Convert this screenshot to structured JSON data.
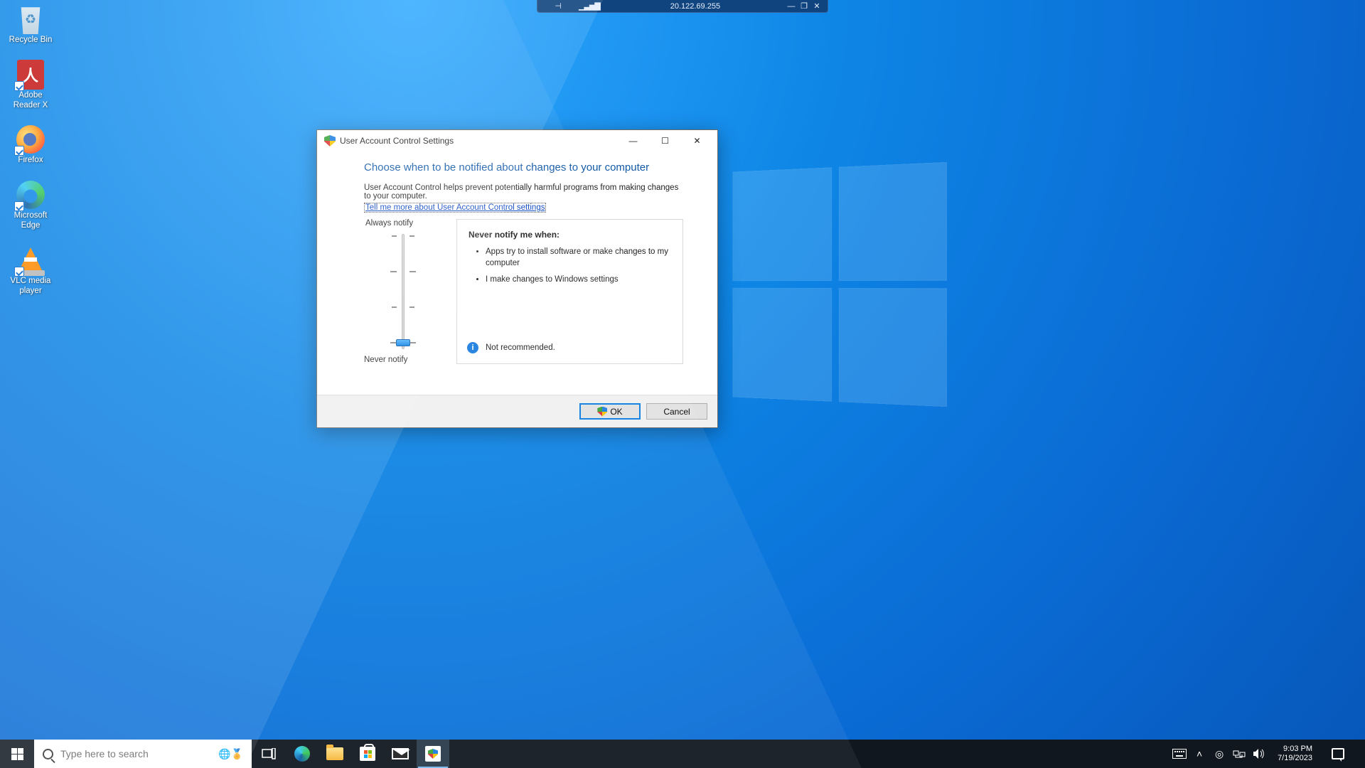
{
  "remote_bar": {
    "pin_icon": "pin-icon",
    "signal_icon": "signal-icon",
    "host": "20.122.69.255",
    "minimize_icon": "minimize-icon",
    "restore_icon": "restore-icon",
    "close_icon": "close-icon"
  },
  "desktop_icons": [
    {
      "id": "recycle-bin",
      "label": "Recycle Bin",
      "has_shortcut": false
    },
    {
      "id": "adobe-reader",
      "label": "Adobe Reader X",
      "has_shortcut": true
    },
    {
      "id": "firefox",
      "label": "Firefox",
      "has_shortcut": true
    },
    {
      "id": "microsoft-edge",
      "label": "Microsoft Edge",
      "has_shortcut": true
    },
    {
      "id": "vlc",
      "label": "VLC media player",
      "has_shortcut": true
    }
  ],
  "uac": {
    "window_title": "User Account Control Settings",
    "heading": "Choose when to be notified about changes to your computer",
    "description": "User Account Control helps prevent potentially harmful programs from making changes to your computer.",
    "link_text": "Tell me more about User Account Control settings",
    "slider": {
      "top_label": "Always notify",
      "bottom_label": "Never notify",
      "levels": 4,
      "current_level": 0
    },
    "notify_box": {
      "title": "Never notify me when:",
      "bullets": [
        "Apps try to install software or make changes to my computer",
        "I make changes to Windows settings"
      ],
      "recommendation": "Not recommended."
    },
    "buttons": {
      "ok": "OK",
      "cancel": "Cancel"
    }
  },
  "taskbar": {
    "search_placeholder": "Type here to search",
    "pinned": [
      {
        "id": "edge",
        "name": "Microsoft Edge",
        "active": false
      },
      {
        "id": "explorer",
        "name": "File Explorer",
        "active": false
      },
      {
        "id": "store",
        "name": "Microsoft Store",
        "active": false
      },
      {
        "id": "mail",
        "name": "Mail",
        "active": false
      },
      {
        "id": "uac",
        "name": "User Account Control Settings",
        "active": true
      }
    ],
    "clock": {
      "time": "9:03 PM",
      "date": "7/19/2023"
    }
  }
}
